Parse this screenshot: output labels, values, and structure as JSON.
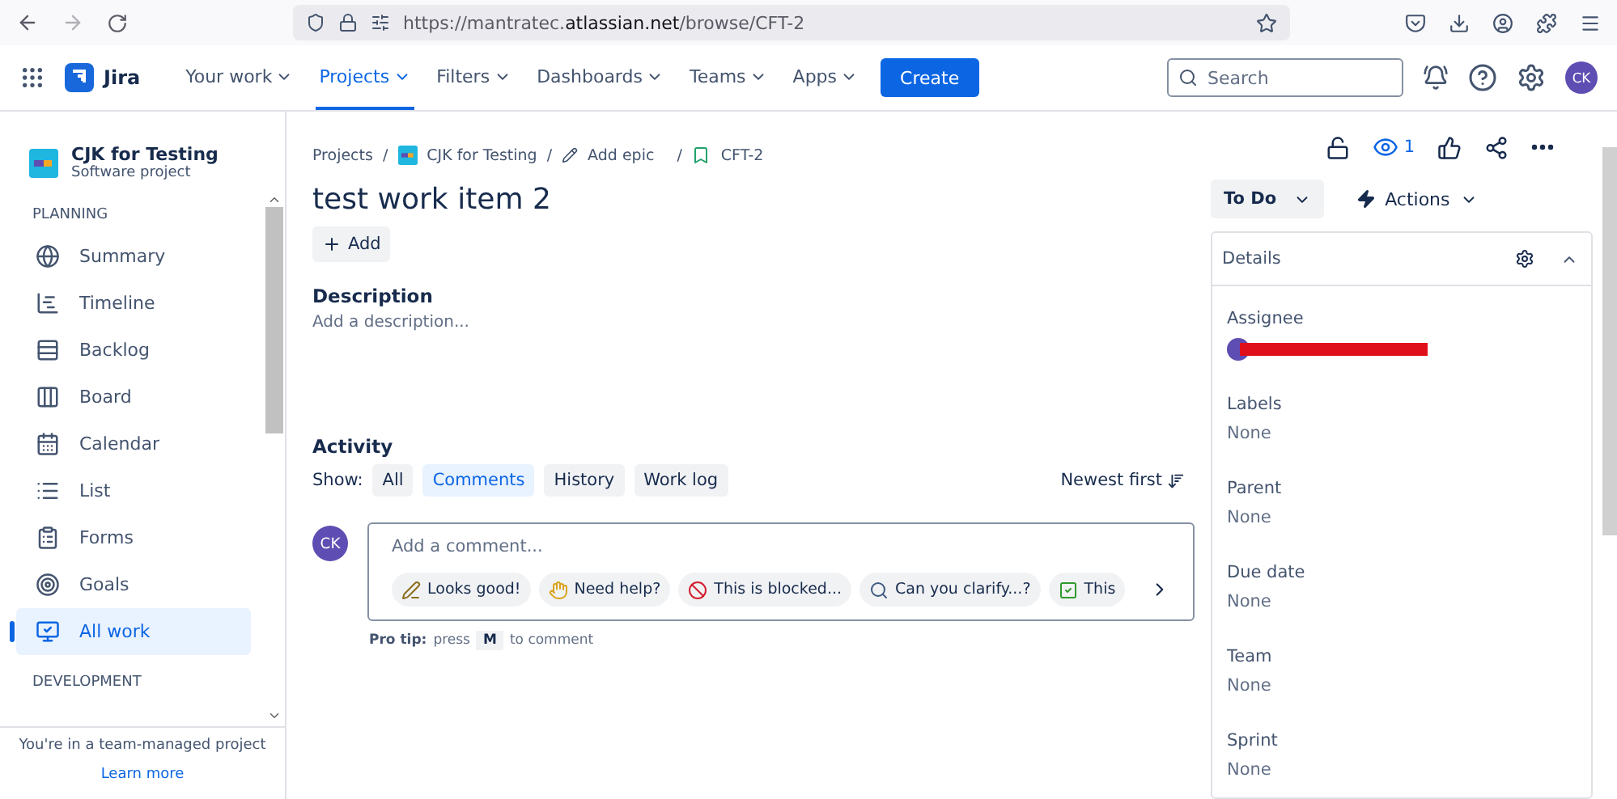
{
  "browser": {
    "url": "https://mantratec.**atlassian.net**/browse/CFT-2"
  },
  "nav": {
    "product": "Jira",
    "items": [
      {
        "label": "Your work",
        "selected": false
      },
      {
        "label": "Projects",
        "selected": true
      },
      {
        "label": "Filters",
        "selected": false
      },
      {
        "label": "Dashboards",
        "selected": false
      },
      {
        "label": "Teams",
        "selected": false
      },
      {
        "label": "Apps",
        "selected": false
      }
    ],
    "create": "Create",
    "search": {
      "placeholder": "Search"
    },
    "avatar": "CK"
  },
  "sidebar": {
    "project": {
      "name": "CJK for Testing",
      "type": "Software project"
    },
    "section": "PLANNING",
    "items": [
      {
        "kind": "summary",
        "label": "Summary",
        "selected": false
      },
      {
        "kind": "timeline",
        "label": "Timeline",
        "selected": false
      },
      {
        "kind": "backlog",
        "label": "Backlog",
        "selected": false
      },
      {
        "kind": "board",
        "label": "Board",
        "selected": false
      },
      {
        "kind": "calendar",
        "label": "Calendar",
        "selected": false
      },
      {
        "kind": "list",
        "label": "List",
        "selected": false
      },
      {
        "kind": "forms",
        "label": "Forms",
        "selected": false
      },
      {
        "kind": "goals",
        "label": "Goals",
        "selected": false
      },
      {
        "kind": "allwork",
        "label": "All work",
        "selected": true
      }
    ],
    "next_section": "DEVELOPMENT",
    "footer": {
      "text": "You're in a team-managed project",
      "link": "Learn more"
    }
  },
  "issue": {
    "breadcrumbs": [
      {
        "kind": "text",
        "label": "Projects"
      },
      {
        "kind": "project",
        "separator": "/",
        "label": "CJK for Testing"
      },
      {
        "kind": "epic",
        "separator": "/",
        "label": "Add epic"
      },
      {
        "kind": "story",
        "separator": "/",
        "label": "CFT-2"
      }
    ],
    "title": "test work item 2",
    "add": "Add",
    "description": {
      "heading": "Description",
      "placeholder": "Add a description..."
    },
    "activity": {
      "heading": "Activity",
      "show": "Show:",
      "filters": [
        {
          "label": "All",
          "selected": false
        },
        {
          "label": "Comments",
          "selected": true
        },
        {
          "label": "History",
          "selected": false
        },
        {
          "label": "Work log",
          "selected": false
        }
      ],
      "sort": "Newest first",
      "avatar": "CK",
      "comment_placeholder": "Add a comment...",
      "chips": [
        {
          "kind": "pencil",
          "label": "Looks good!"
        },
        {
          "kind": "hand",
          "label": "Need help?"
        },
        {
          "kind": "blocked",
          "label": "This is blocked..."
        },
        {
          "kind": "search",
          "label": "Can you clarify...?"
        },
        {
          "kind": "check",
          "label": "This"
        }
      ],
      "pro_tip": {
        "label": "Pro tip:",
        "press": "press",
        "key": "M",
        "rest": "to comment"
      }
    }
  },
  "side_panel": {
    "watchers": "1",
    "status": "To Do",
    "actions": "Actions",
    "details": {
      "title": "Details",
      "expanded": true,
      "fields": [
        {
          "kind": "user",
          "label": "Assignee"
        },
        {
          "kind": "text",
          "label": "Labels",
          "value": "None"
        },
        {
          "kind": "text",
          "label": "Parent",
          "value": "None"
        },
        {
          "kind": "text",
          "label": "Due date",
          "value": "None"
        },
        {
          "kind": "text",
          "label": "Team",
          "value": "None"
        },
        {
          "kind": "text",
          "label": "Sprint",
          "value": "None"
        }
      ]
    }
  }
}
